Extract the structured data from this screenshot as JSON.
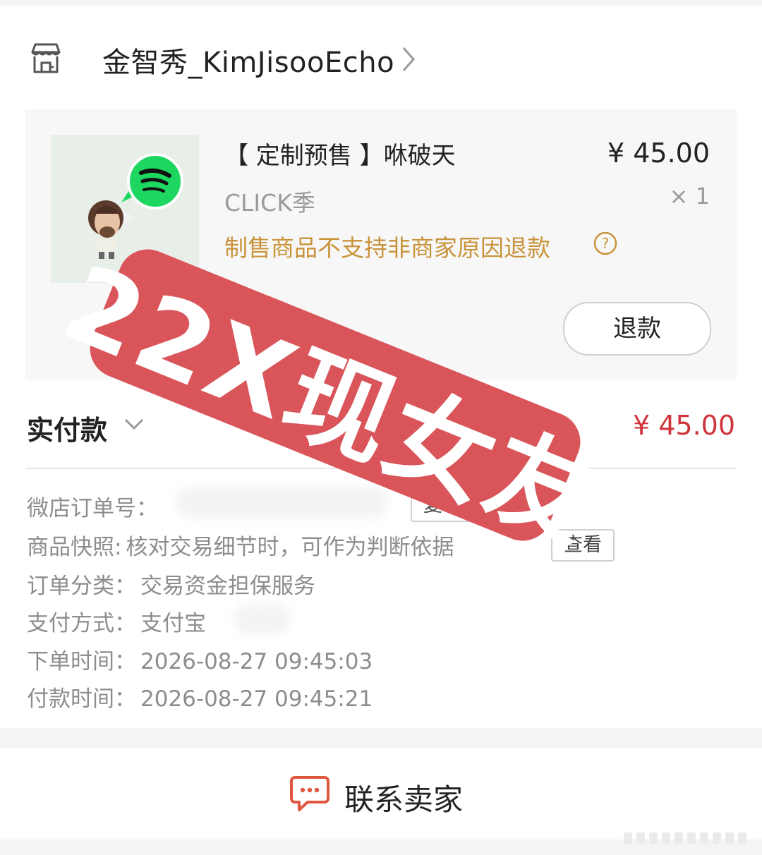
{
  "shop": {
    "name": "金智秀_KimJisooEcho",
    "icon": "store-icon"
  },
  "product": {
    "title": "【 定制预售 】咻破天",
    "price": "¥ 45.00",
    "variant": "CLICK季",
    "quantity": "× 1",
    "refund_note": "制售商品不支持非商家原因退款",
    "refund_button": "退款"
  },
  "payment": {
    "label": "实付款",
    "amount": "¥ 45.00"
  },
  "details": {
    "order_no_label": "微店订单号：",
    "copy_button": "复制",
    "snapshot_label": "商品快照:",
    "snapshot_value": "核对交易细节时，可作为判断依据",
    "view_button": "查看",
    "category_label": "订单分类：",
    "category_value": "交易资金担保服务",
    "pay_method_label": "支付方式：",
    "pay_method_value": "支付宝",
    "order_time_label": "下单时间：",
    "order_time_value": "2026-08-27 09:45:03",
    "pay_time_label": "付款时间：",
    "pay_time_value": "2026-08-27 09:45:21"
  },
  "contact": {
    "label": "联系卖家",
    "icon": "chat-bubble-icon"
  },
  "overlay": {
    "stamp_text": "22X现女友"
  },
  "colors": {
    "accent_red": "#d0343a",
    "note_orange": "#c9933a",
    "stamp_red": "#d9555a",
    "spotify_green": "#1ed760"
  }
}
